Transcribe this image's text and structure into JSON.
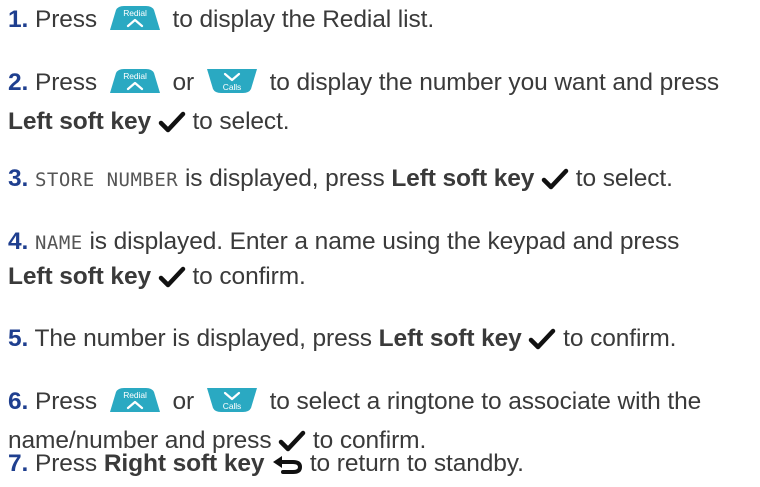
{
  "steps": [
    {
      "number": "1.",
      "parts": {
        "press": "Press",
        "after_redial": "to display the Redial list."
      }
    },
    {
      "number": "2.",
      "parts": {
        "press": "Press",
        "or": "or",
        "after_calls": "to display the number you want and press",
        "left_soft_key": "Left soft key",
        "after_check": "to select."
      }
    },
    {
      "number": "3.",
      "parts": {
        "display": "STORE NUMBER",
        "middle": "is displayed, press",
        "left_soft_key": "Left soft key",
        "after_check": "to select."
      }
    },
    {
      "number": "4.",
      "parts": {
        "display": "NAME",
        "middle": "is displayed. Enter a name using the keypad and press",
        "left_soft_key": "Left soft key",
        "after_check": "to confirm."
      }
    },
    {
      "number": "5.",
      "parts": {
        "middle": "The number is displayed, press",
        "left_soft_key": "Left soft key",
        "after_check": "to confirm."
      }
    },
    {
      "number": "6.",
      "parts": {
        "press": "Press",
        "or": "or",
        "after_calls": "to select a ringtone to associate with the",
        "line2": "name/number and press",
        "after_check": "to confirm."
      }
    },
    {
      "number": "7.",
      "parts": {
        "press": "Press",
        "right_soft_key": "Right soft key",
        "after_back": "to return to standby."
      }
    }
  ],
  "keys": {
    "redial": {
      "label": "Redial",
      "icon": "chevron-up-icon"
    },
    "calls": {
      "label": "Calls",
      "icon": "chevron-down-icon"
    }
  },
  "colors": {
    "step_number": "#1f3f8f",
    "key_fill": "#2aa9c2",
    "text": "#3a3a3a"
  }
}
